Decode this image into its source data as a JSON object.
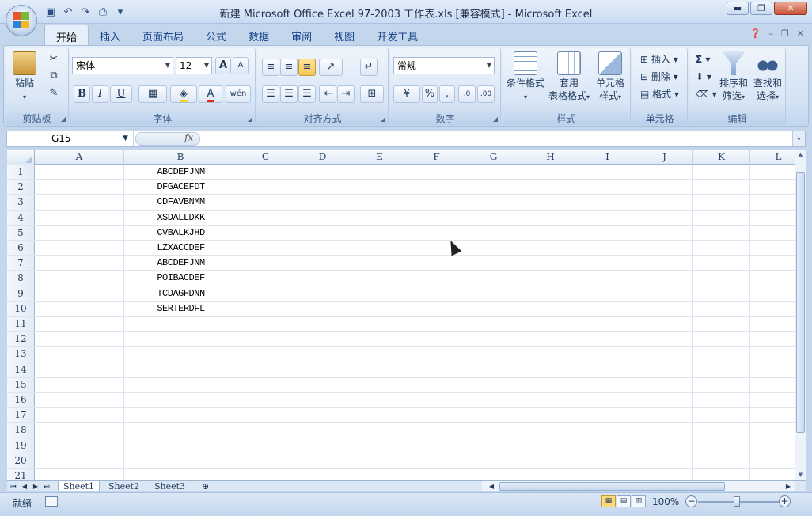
{
  "window": {
    "title": "新建 Microsoft Office Excel 97-2003 工作表.xls  [兼容模式] - Microsoft Excel",
    "controls": [
      "▬",
      "❐",
      "✕"
    ]
  },
  "qat": [
    "save-icon",
    "undo-icon",
    "redo-icon",
    "print-preview-icon",
    "customize-icon"
  ],
  "tabs": [
    "开始",
    "插入",
    "页面布局",
    "公式",
    "数据",
    "审阅",
    "视图",
    "开发工具"
  ],
  "ribbon": {
    "clipboard": {
      "label": "剪贴板",
      "paste": "粘贴"
    },
    "font": {
      "label": "字体",
      "font_name": "宋体",
      "font_size": "12",
      "bold": "B",
      "italic": "I",
      "underline": "U",
      "grow": "A",
      "shrink": "A",
      "color_letter": "A",
      "phonetic": "wén"
    },
    "alignment": {
      "label": "对齐方式"
    },
    "number": {
      "label": "数字",
      "format": "常规",
      "percent": "%",
      "comma": ","
    },
    "styles": {
      "label": "样式",
      "conditional": "条件格式",
      "table_format_1": "套用",
      "table_format_2": "表格格式",
      "cell_style_1": "单元格",
      "cell_style_2": "样式"
    },
    "cells": {
      "label": "单元格",
      "insert": "插入",
      "delete": "删除",
      "format": "格式"
    },
    "editing": {
      "label": "编辑",
      "sum": "Σ",
      "sort_1": "排序和",
      "sort_2": "筛选",
      "find_1": "查找和",
      "find_2": "选择"
    }
  },
  "formula_bar": {
    "name_box": "G15",
    "fx": "fx",
    "formula": ""
  },
  "columns": [
    "A",
    "B",
    "C",
    "D",
    "E",
    "F",
    "G",
    "H",
    "I",
    "J",
    "K",
    "L"
  ],
  "rows": [
    {
      "n": "1",
      "b": "ABCDEFJNM"
    },
    {
      "n": "2",
      "b": "DFGACEFDT"
    },
    {
      "n": "3",
      "b": "CDFAVBNMM"
    },
    {
      "n": "4",
      "b": "XSDALLDKK"
    },
    {
      "n": "5",
      "b": "CVBALKJHD"
    },
    {
      "n": "6",
      "b": "LZXACCDEF"
    },
    {
      "n": "7",
      "b": "ABCDEFJNM"
    },
    {
      "n": "8",
      "b": "POIBACDEF"
    },
    {
      "n": "9",
      "b": "TCDAGHDNN"
    },
    {
      "n": "10",
      "b": "SERTERDFL"
    },
    {
      "n": "11",
      "b": ""
    },
    {
      "n": "12",
      "b": ""
    },
    {
      "n": "13",
      "b": ""
    },
    {
      "n": "14",
      "b": ""
    },
    {
      "n": "15",
      "b": ""
    },
    {
      "n": "16",
      "b": ""
    },
    {
      "n": "17",
      "b": ""
    },
    {
      "n": "18",
      "b": ""
    },
    {
      "n": "19",
      "b": ""
    },
    {
      "n": "20",
      "b": ""
    },
    {
      "n": "21",
      "b": ""
    }
  ],
  "sheets": [
    "Sheet1",
    "Sheet2",
    "Sheet3"
  ],
  "status": {
    "text": "就绪",
    "zoom": "100%"
  }
}
